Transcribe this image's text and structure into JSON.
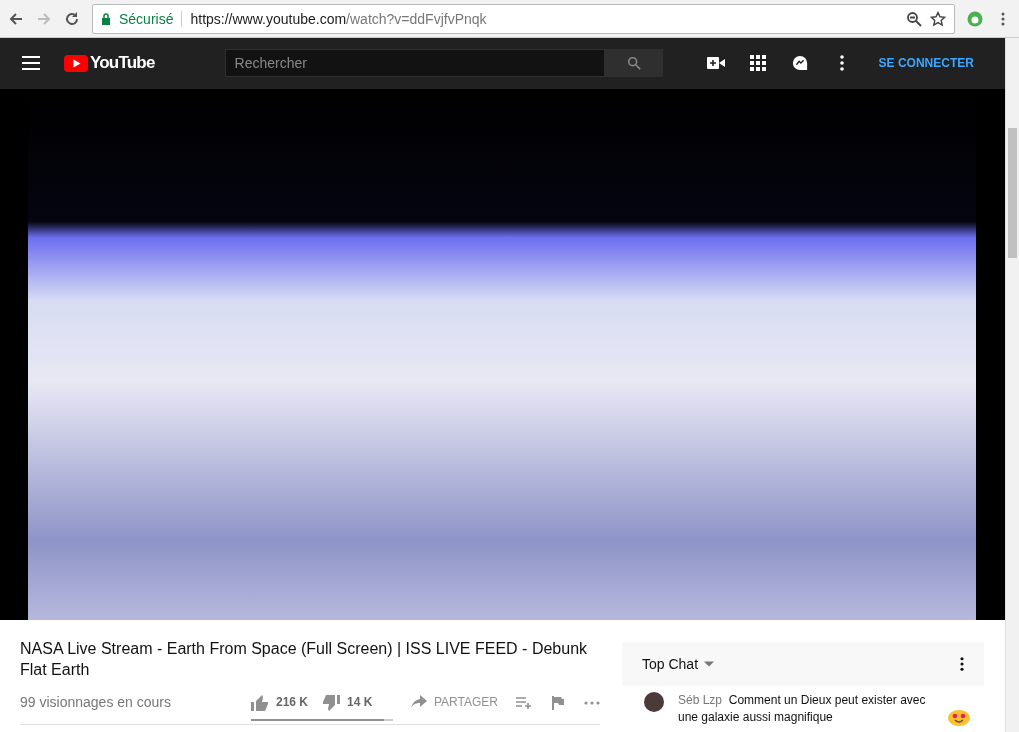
{
  "browser": {
    "security_label": "Sécurisé",
    "url_host": "https://www.youtube.com",
    "url_path": "/watch?v=ddFvjfvPnqk"
  },
  "header": {
    "logo": "YouTube",
    "search": {
      "placeholder": "Rechercher"
    },
    "sign_in": "SE CONNECTER"
  },
  "video": {
    "title": "NASA Live Stream - Earth From Space (Full Screen) | ISS LIVE FEED - Debunk Flat Earth",
    "views": "99 visionnages en cours",
    "likes": "216 K",
    "dislikes": "14 K",
    "share": "PARTAGER",
    "sentiment": {
      "level": 0.94
    }
  },
  "chat": {
    "header": "Top Chat",
    "messages": [
      {
        "author": "Séb Lzp",
        "text": "Comment un Dieux peut exister avec une galaxie aussi magnifique"
      }
    ]
  }
}
